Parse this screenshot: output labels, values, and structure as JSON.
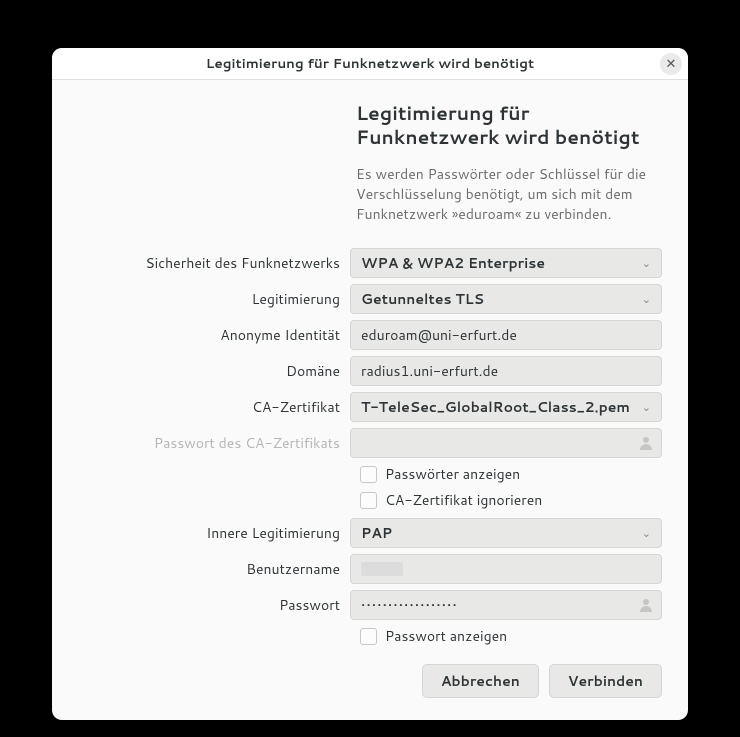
{
  "titlebar": {
    "title": "Legitimierung für Funknetzwerk wird benötigt"
  },
  "heading": "Legitimierung für Funknetzwerk wird benötigt",
  "description": "Es werden Passwörter oder Schlüssel für die Verschlüsselung benötigt, um sich mit dem Funknetzwerk »eduroam« zu verbinden.",
  "labels": {
    "security": "Sicherheit des Funknetzwerks",
    "auth": "Legitimierung",
    "anon": "Anonyme Identität",
    "domain": "Domäne",
    "cacert": "CA-Zertifikat",
    "capass": "Passwort des CA-Zertifikats",
    "show_pw": "Passwörter anzeigen",
    "ignore_ca": "CA-Zertifikat ignorieren",
    "inner": "Innere Legitimierung",
    "user": "Benutzername",
    "pass": "Passwort",
    "show_pw2": "Passwort anzeigen"
  },
  "values": {
    "security": "WPA & WPA2 Enterprise",
    "auth": "Getunneltes TLS",
    "anon": "eduroam@uni-erfurt.de",
    "domain": "radius1.uni-erfurt.de",
    "cacert": "T-TeleSec_GlobalRoot_Class_2.pem",
    "inner": "PAP",
    "pass": "••••••••••••••••••"
  },
  "buttons": {
    "cancel": "Abbrechen",
    "connect": "Verbinden"
  }
}
